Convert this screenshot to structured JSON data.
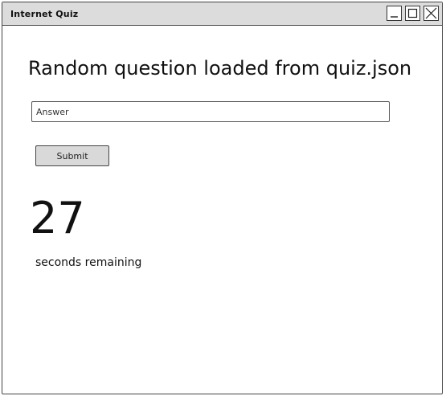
{
  "window": {
    "title": "Internet Quiz",
    "controls": [
      "minimize",
      "maximize",
      "close"
    ]
  },
  "quiz": {
    "question": "Random question loaded from quiz.json",
    "answer_value": "",
    "answer_placeholder": "Answer",
    "submit_label": "Submit"
  },
  "timer": {
    "seconds": "27",
    "label": "seconds remaining"
  },
  "icons": {
    "minimize": "minimize-icon",
    "maximize": "maximize-icon",
    "close": "close-icon"
  },
  "colors": {
    "titlebar": "#dcdcdc",
    "border": "#444444",
    "button": "#d9d9d9"
  }
}
